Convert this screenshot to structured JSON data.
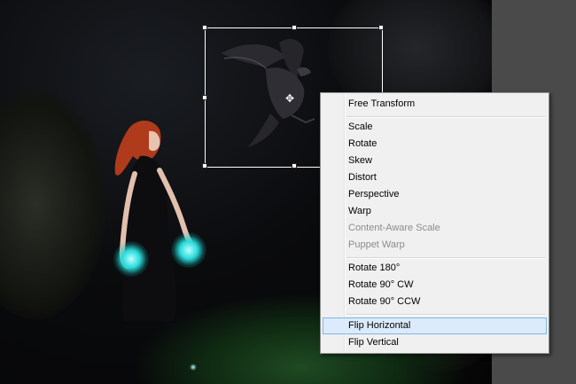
{
  "context_menu": {
    "items": [
      {
        "label": "Free Transform",
        "enabled": true
      },
      {
        "label": "Scale",
        "enabled": true
      },
      {
        "label": "Rotate",
        "enabled": true
      },
      {
        "label": "Skew",
        "enabled": true
      },
      {
        "label": "Distort",
        "enabled": true
      },
      {
        "label": "Perspective",
        "enabled": true
      },
      {
        "label": "Warp",
        "enabled": true
      },
      {
        "label": "Content-Aware Scale",
        "enabled": false
      },
      {
        "label": "Puppet Warp",
        "enabled": false
      },
      {
        "label": "Rotate 180°",
        "enabled": true
      },
      {
        "label": "Rotate 90° CW",
        "enabled": true
      },
      {
        "label": "Rotate 90° CCW",
        "enabled": true
      },
      {
        "label": "Flip Horizontal",
        "enabled": true,
        "highlighted": true
      },
      {
        "label": "Flip Vertical",
        "enabled": true
      }
    ]
  },
  "colors": {
    "menu_background": "#f0f0f0",
    "menu_highlight": "#dcebfc",
    "menu_highlight_border": "#7eb4ea",
    "disabled_text": "#8c8c8c",
    "transform_box": "#ffffff",
    "glow": "#29d9d9",
    "canvas_background": "#0a0b0d",
    "workspace_background": "#4a4a4a"
  },
  "icons": {
    "cursor": "crosshair-move-cursor-icon"
  }
}
